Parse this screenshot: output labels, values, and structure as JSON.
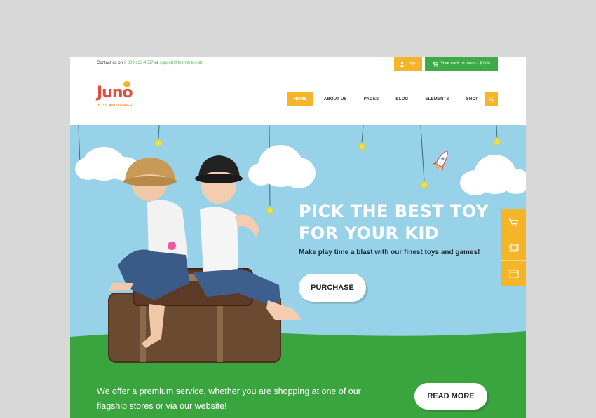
{
  "topbar": {
    "contact_prefix": "Contact us on",
    "phone": "0 800 123-4567",
    "or": "or",
    "email": "support@themerex.net",
    "login_label": "Login",
    "cart_label": "Your cart:",
    "cart_value": "0 items - $0.00"
  },
  "logo": {
    "title": "Juno",
    "subtitle": "TOYS AND GAMES"
  },
  "nav": {
    "items": [
      {
        "label": "HOME"
      },
      {
        "label": "ABOUT US"
      },
      {
        "label": "PAGES"
      },
      {
        "label": "BLOG"
      },
      {
        "label": "ELEMENTS"
      },
      {
        "label": "SHOP"
      }
    ],
    "search_icon": "search-icon"
  },
  "hero": {
    "headline_line1": "PICK THE BEST TOY",
    "headline_line2": "FOR YOUR KID",
    "subline": "Make play time a blast with our finest toys and games!",
    "purchase_label": "PURCHASE",
    "offer_text": "We offer a premium service, whether you are shopping at one of our flagship stores or via our website!",
    "read_more_label": "READ MORE"
  },
  "side_tools": [
    "cart-icon",
    "gallery-icon",
    "window-icon"
  ],
  "colors": {
    "accent": "#f4b528",
    "green": "#3dab48",
    "sky": "#97d2e8",
    "logo_red": "#e84a3a",
    "grass": "#3aa53f"
  }
}
